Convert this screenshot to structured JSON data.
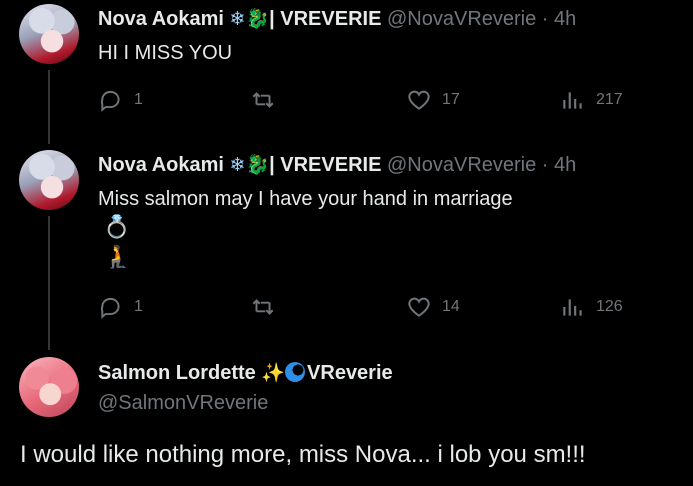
{
  "tweets": [
    {
      "name": "Nova Aokami",
      "name_emojis": "❄🐉",
      "tag": "| VREVERIE",
      "handle": "@NovaVReverie",
      "time": "· 4h",
      "text": "HI I MISS YOU",
      "reply_count": "1",
      "retweet_count": "",
      "like_count": "17",
      "view_count": "217"
    },
    {
      "name": "Nova Aokami",
      "name_emojis": "❄🐉",
      "tag": "| VREVERIE",
      "handle": "@NovaVReverie",
      "time": "· 4h",
      "text": "Miss salmon may I have your hand in marriage",
      "extra_emojis": [
        "💍",
        "🧎"
      ],
      "reply_count": "1",
      "retweet_count": "",
      "like_count": "14",
      "view_count": "126"
    }
  ],
  "main_tweet": {
    "name": "Salmon Lordette",
    "name_emojis": "✨",
    "tag": "VReverie",
    "handle": "@SalmonVReverie",
    "text": "I would like nothing more, miss Nova... i lob you sm!!!"
  },
  "colors": {
    "background": "#000000",
    "text": "#e7e9ea",
    "muted": "#71767b",
    "thread_line": "#333639"
  },
  "icons": {
    "reply": "reply-icon",
    "retweet": "retweet-icon",
    "like": "heart-icon",
    "views": "views-icon"
  }
}
